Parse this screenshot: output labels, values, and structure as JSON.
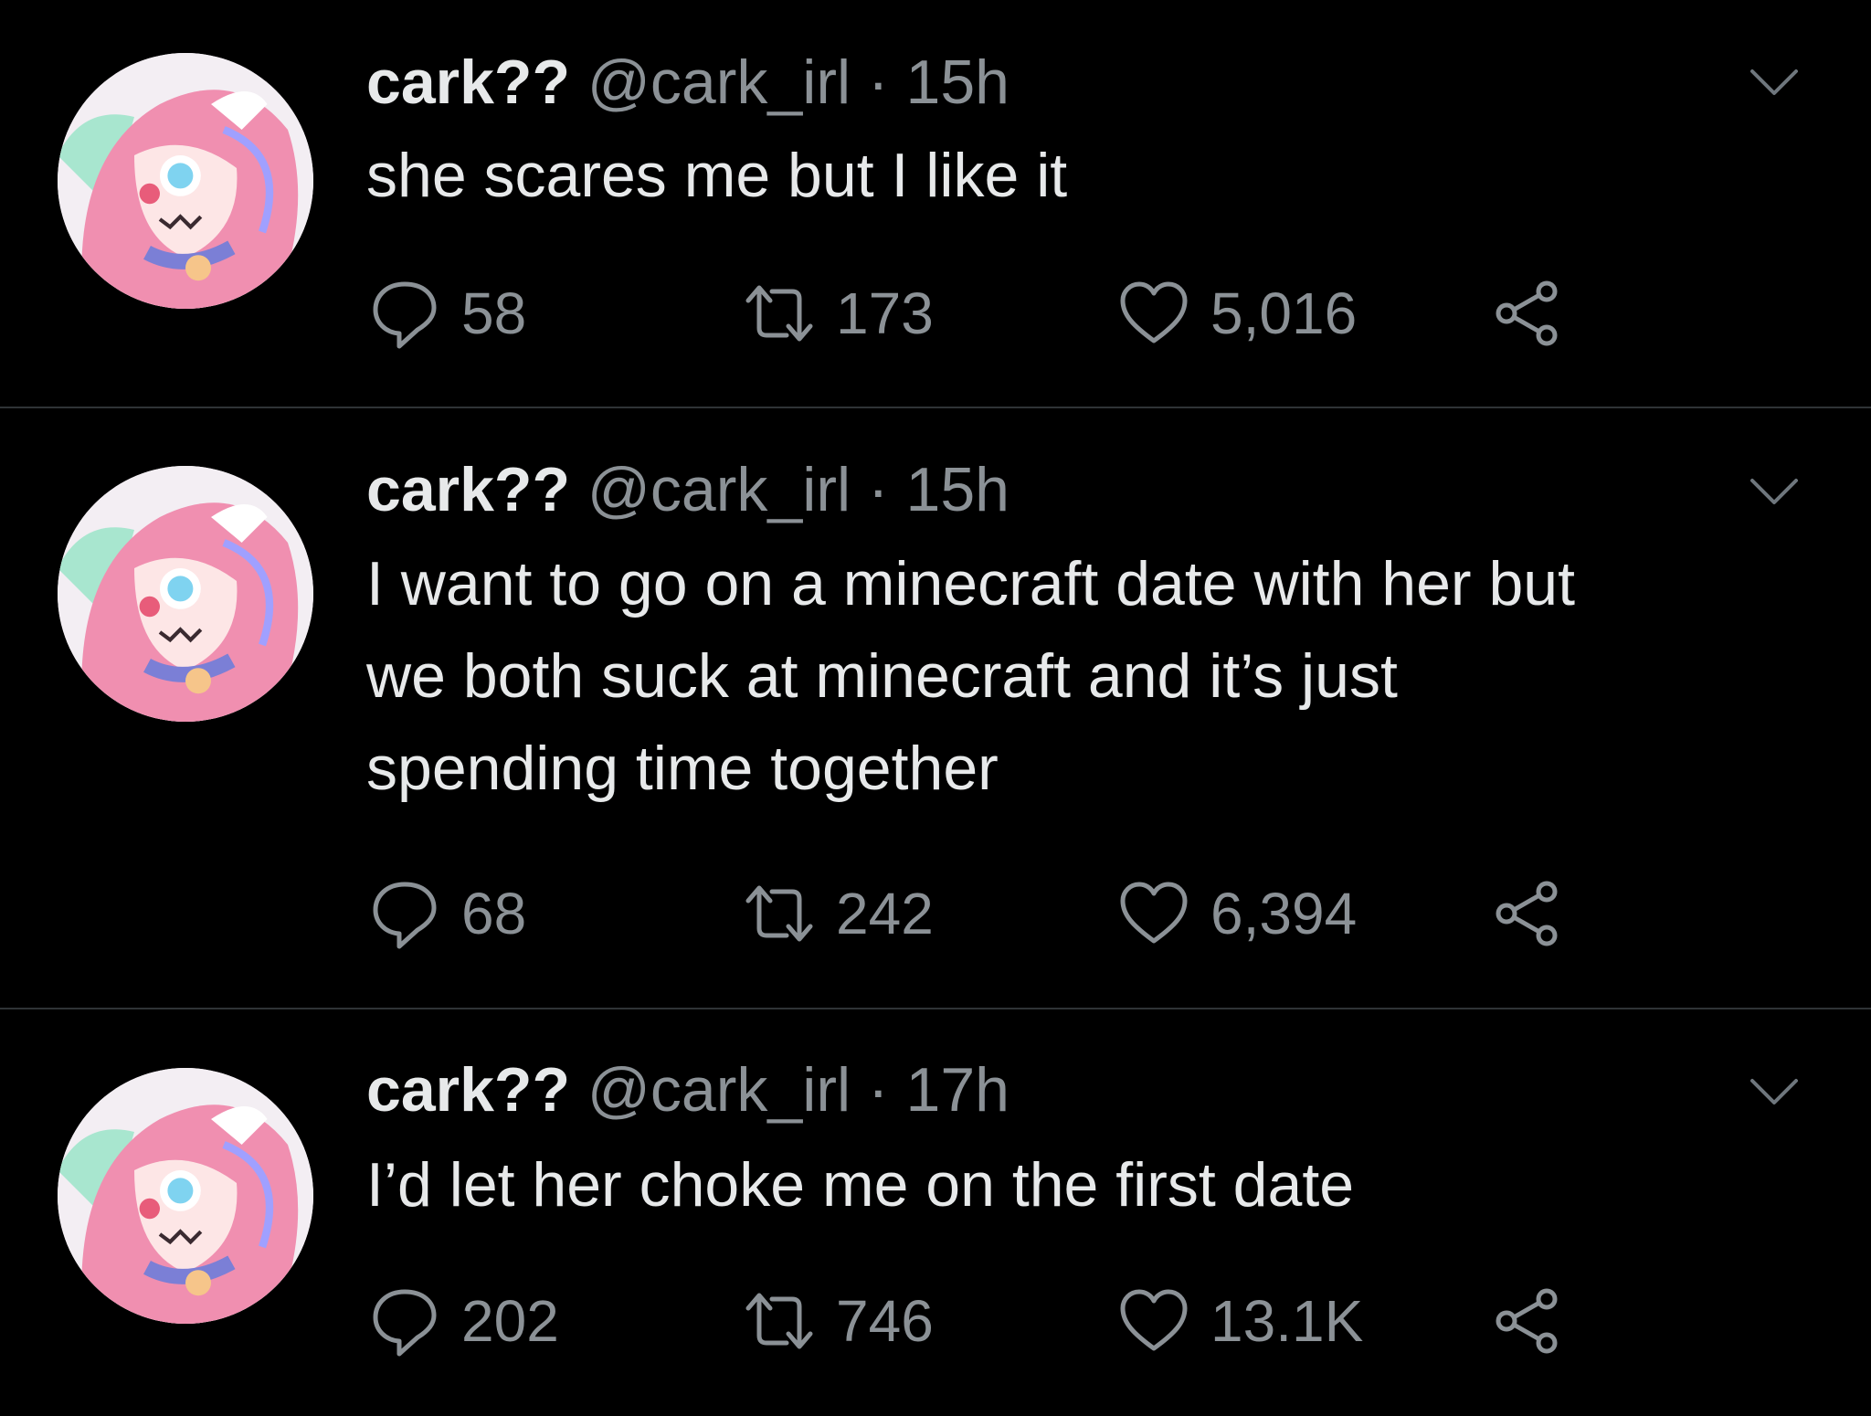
{
  "tweets": [
    {
      "name": "cark??",
      "handle": "@cark_irl",
      "separator": "·",
      "time": "15h",
      "text": "she scares me but I like it",
      "replies": "58",
      "retweets": "173",
      "likes": "5,016"
    },
    {
      "name": "cark??",
      "handle": "@cark_irl",
      "separator": "·",
      "time": "15h",
      "text": "I want to go on a minecraft date with her but\nwe both suck at minecraft and it’s just\nspending time together",
      "replies": "68",
      "retweets": "242",
      "likes": "6,394"
    },
    {
      "name": "cark??",
      "handle": "@cark_irl",
      "separator": "·",
      "time": "17h",
      "text": "I’d let her choke me on the first date",
      "replies": "202",
      "retweets": "746",
      "likes": "13.1K"
    }
  ],
  "icons": {
    "reply": "reply-icon",
    "retweet": "retweet-icon",
    "like": "heart-icon",
    "share": "share-icon",
    "caret": "chevron-down-icon"
  },
  "colors": {
    "background": "#000000",
    "text": "#e7e9ea",
    "secondary": "#8b9196",
    "divider": "#2f3336"
  }
}
